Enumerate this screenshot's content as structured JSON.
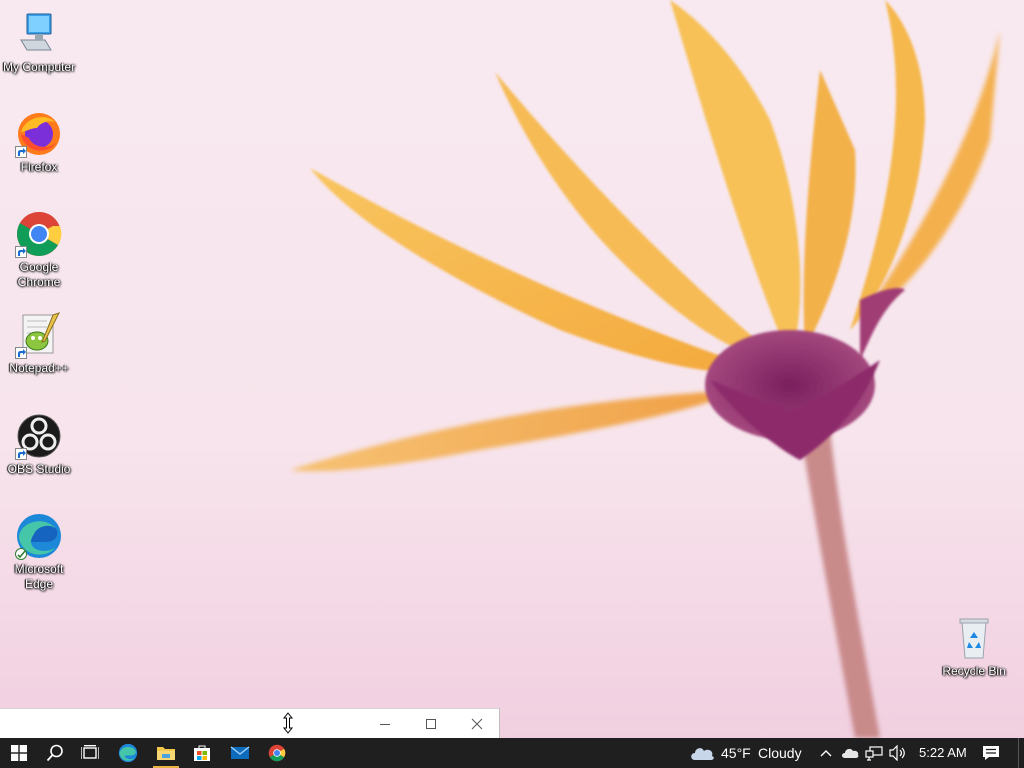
{
  "desktop": {
    "icons": [
      {
        "label": "My Computer"
      },
      {
        "label": "Firefox"
      },
      {
        "label": "Google Chrome"
      },
      {
        "label": "Notepad++"
      },
      {
        "label": "OBS Studio"
      },
      {
        "label": "Microsoft Edge"
      },
      {
        "label": "Recycle Bin"
      }
    ]
  },
  "window": {
    "minimize_icon": "minimize-icon",
    "maximize_icon": "maximize-icon",
    "close_icon": "close-icon"
  },
  "taskbar": {
    "start_icon": "windows-logo-icon",
    "pinned": [
      "search-icon",
      "task-view-icon",
      "edge-icon",
      "file-explorer-icon",
      "microsoft-store-icon",
      "mail-icon",
      "chrome-icon"
    ],
    "weather": {
      "temp": "45°F",
      "condition": "Cloudy"
    },
    "clock": "5:22 AM",
    "accent": "#e8b340"
  }
}
